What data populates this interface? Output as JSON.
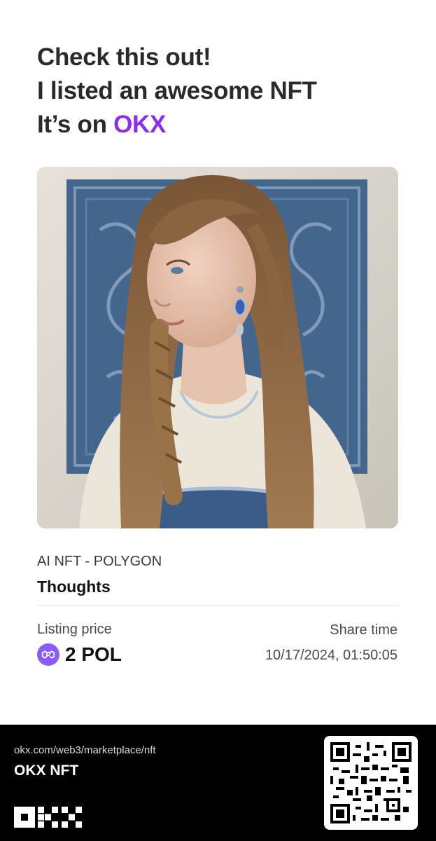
{
  "headline": {
    "line1": "Check this out!",
    "line2": "I listed an awesome NFT",
    "line3_prefix": "It’s on ",
    "line3_accent": "OKX"
  },
  "nft": {
    "image_alt": "AI portrait of a woman with long braided hair against a blue ornamental tapestry",
    "collection": "AI NFT - POLYGON",
    "name": "Thoughts"
  },
  "listing": {
    "price_label": "Listing price",
    "price_value": "2 POL",
    "token_icon": "polygon-icon",
    "share_label": "Share time",
    "share_time": "10/17/2024, 01:50:05"
  },
  "footer": {
    "url": "okx.com/web3/marketplace/nft",
    "title": "OKX NFT",
    "logo": "okx-logo"
  },
  "colors": {
    "accent": "#8d2ee8",
    "polygon": "#8b5cf6",
    "footer_bg": "#000000"
  }
}
